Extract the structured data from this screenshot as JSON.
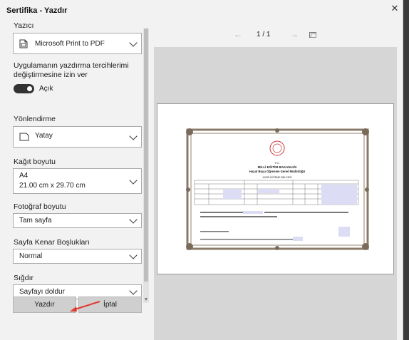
{
  "dialog": {
    "title": "Sertifika - Yazdır",
    "close_glyph": "✕"
  },
  "printer": {
    "label": "Yazıcı",
    "value": "Microsoft Print to PDF",
    "icon": "printer-icon"
  },
  "preferences": {
    "label_line1": "Uygulamanın yazdırma tercihlerimi",
    "label_line2": "değiştirmesine izin ver",
    "toggle_label": "Açık",
    "on": true
  },
  "orientation": {
    "label": "Yönlendirme",
    "value": "Yatay",
    "icon": "page-landscape-icon"
  },
  "paper_size": {
    "label": "Kağıt boyutu",
    "value": "A4",
    "detail": "21.00 cm x 29.70 cm"
  },
  "photo_size": {
    "label": "Fotoğraf boyutu",
    "value": "Tam sayfa"
  },
  "margins": {
    "label": "Sayfa Kenar Boşlukları",
    "value": "Normal"
  },
  "fit": {
    "label": "Sığdır",
    "value": "Sayfayı doldur"
  },
  "buttons": {
    "print": "Yazdır",
    "cancel": "İptal"
  },
  "preview": {
    "page_indicator": "1 / 1",
    "prev_glyph": "←",
    "next_glyph": "→"
  },
  "certificate": {
    "org_prefix": "T.C.",
    "ministry": "MİLLİ EĞİTİM BAKANLIĞI",
    "directorate": "Hayat Boyu Öğrenme Genel Müdürlüğü",
    "doc_type": "KURS BİTİRME BELGESİ"
  },
  "colors": {
    "accent_arrow": "#e03a2f",
    "toggle_on": "#333333",
    "button_bg": "#cfcfcf"
  }
}
